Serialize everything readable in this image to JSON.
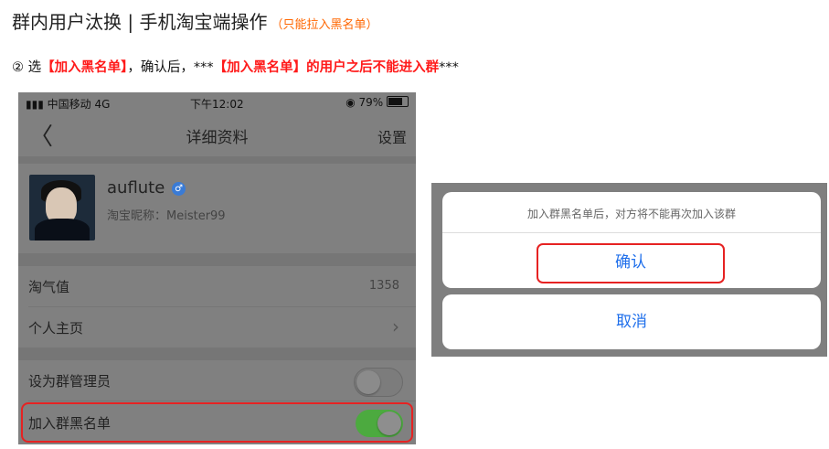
{
  "header": {
    "title": "群内用户汰换 | 手机淘宝端操作",
    "hint": "（只能拉入黑名单）"
  },
  "step": {
    "num": "②",
    "t1": " 选",
    "t2": "【加入黑名单】",
    "t3": "，确认后，***",
    "t4": "【加入黑名单】的用户之后不能进入群",
    "t5": "***"
  },
  "phone": {
    "status": {
      "carrier": "中国移动",
      "network": "4G",
      "time": "下午12:02",
      "battery": "79%"
    },
    "nav": {
      "back": "〈",
      "title": "详细资料",
      "settings": "设置"
    },
    "profile": {
      "username": "auflute",
      "gender_symbol": "♂",
      "nickname": "淘宝昵称：Meister99"
    },
    "rows": {
      "taoqi_label": "淘气值",
      "taoqi_value": "1358",
      "homepage_label": "个人主页",
      "admin_label": "设为群管理员",
      "blacklist_label": "加入群黑名单"
    },
    "toggles": {
      "admin_on": false,
      "blacklist_on": true
    }
  },
  "dialog": {
    "message": "加入群黑名单后，对方将不能再次加入该群",
    "confirm": "确认",
    "cancel": "取消"
  },
  "colors": {
    "accent_red": "#e62222",
    "link_blue": "#1f6feb",
    "toggle_green": "#4caa3f",
    "hint_orange": "#ff6600"
  }
}
